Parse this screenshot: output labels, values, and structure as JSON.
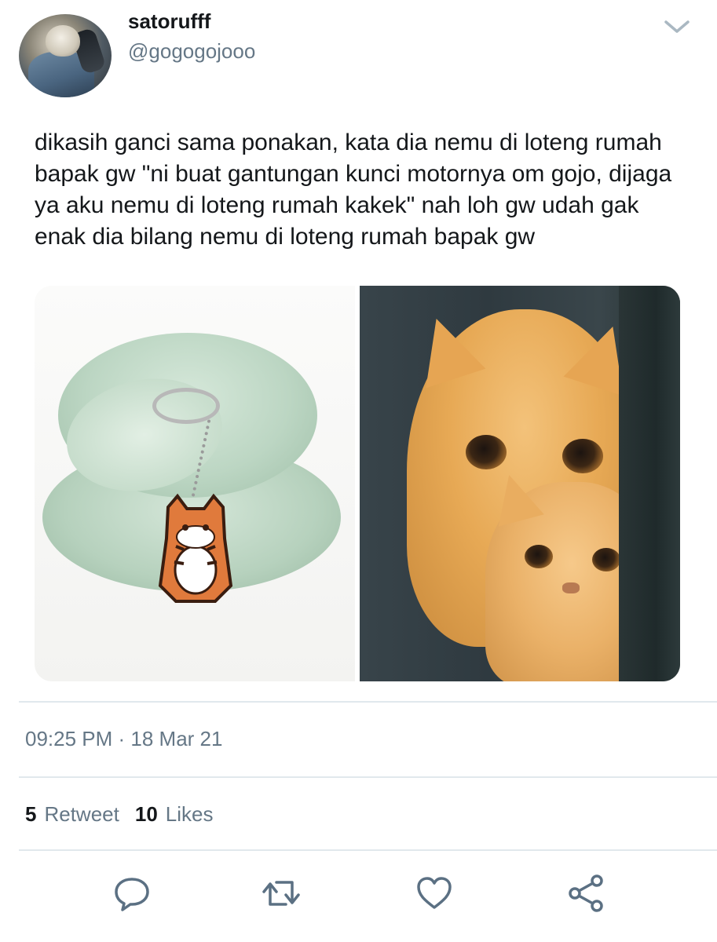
{
  "user": {
    "display_name": "satorufff",
    "handle": "@gogogojooo"
  },
  "tweet": {
    "text": "dikasih ganci sama ponakan, kata dia nemu di loteng rumah bapak gw \"ni buat gantungan kunci motornya om gojo, dijaga ya aku nemu di loteng rumah kakek\" nah loh gw udah gak enak dia bilang nemu di loteng rumah bapak gw",
    "timestamp": "09:25 PM · 18 Mar 21"
  },
  "stats": {
    "retweets_count": "5",
    "retweets_label": "Retweet",
    "likes_count": "10",
    "likes_label": "Likes"
  },
  "icons": {
    "menu": "chevron-down-icon",
    "reply": "reply-icon",
    "retweet": "retweet-icon",
    "like": "heart-icon",
    "share": "share-icon"
  },
  "colors": {
    "text_primary": "#14171a",
    "text_secondary": "#657786",
    "icon": "#5b7083",
    "divider": "#e1e8ed"
  }
}
